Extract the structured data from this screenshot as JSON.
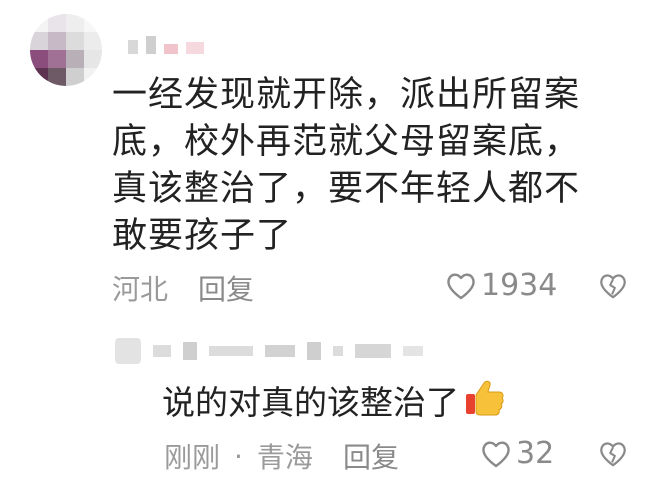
{
  "comment": {
    "text": "一经发现就开除，派出所留案底，校外再范就父母留案底，真该整治了，要不年轻人都不敢要孩子了",
    "location": "河北",
    "reply_label": "回复",
    "like_count": "1934"
  },
  "reply": {
    "text": "说的对真的该整治了",
    "time": "刚刚",
    "separator": "·",
    "location": "青海",
    "reply_label": "回复",
    "like_count": "32"
  },
  "colors": {
    "meta_text": "#9a9a9a",
    "body_text": "#222222"
  },
  "icons": {
    "like": "heart-outline-icon",
    "dislike": "broken-heart-icon",
    "reply_emoji": "thumbs-up-emoji"
  }
}
